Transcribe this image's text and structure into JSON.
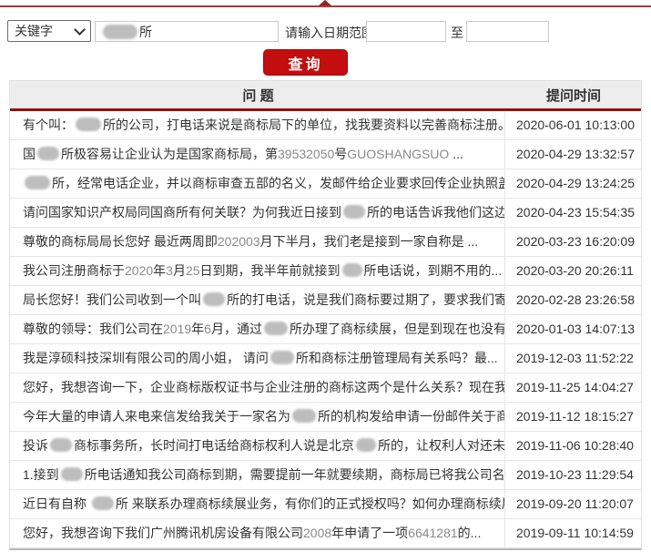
{
  "page": {
    "accent_red": "#c40d0e",
    "header_rule_red": "#9b0d0d",
    "top_rule_red": "#a43b3b"
  },
  "search": {
    "field_select": {
      "value": "关键字"
    },
    "keyword_input": {
      "visible_text": "所",
      "redacted_prefix": true
    },
    "date_range_label": "请输入日期范围",
    "to_label": "至",
    "date_from_value": "",
    "date_to_value": "",
    "submit_label": "查询"
  },
  "table": {
    "headers": {
      "question": "问 题",
      "time": "提问时间"
    },
    "rows": [
      {
        "q": [
          {
            "t": "有个叫："
          },
          {
            "r": 28
          },
          {
            "t": "所的公司，打电话来说是商标局下的单位，找我要资料以完善商标注册。但我..."
          }
        ],
        "time": "2020-06-01 10:13:00"
      },
      {
        "q": [
          {
            "t": "国"
          },
          {
            "r": 24
          },
          {
            "t": "所极容易让企业认为是国家商标局，第"
          },
          {
            "g": "39532050"
          },
          {
            "t": "号"
          },
          {
            "g": "GUOSHANGSUO"
          },
          {
            "t": " ..."
          }
        ],
        "time": "2020-04-29 13:32:57"
      },
      {
        "q": [
          {
            "r": 28
          },
          {
            "t": "所，经常电话企业，并以商标审查五部的名义，发邮件给企业要求回传企业执照盖章扫..."
          }
        ],
        "time": "2020-04-29 13:24:25"
      },
      {
        "q": [
          {
            "t": "请问国家知识产权局同国商所有何关联？为何我近日接到"
          },
          {
            "r": 24
          },
          {
            "t": "所的电话告诉我他们这边是知..."
          }
        ],
        "time": "2020-04-23 15:54:35"
      },
      {
        "q": [
          {
            "t": "尊敬的商标局局长您好 最近两周即"
          },
          {
            "g": "202003"
          },
          {
            "t": "月下半月，我们老是接到一家自称是 ..."
          }
        ],
        "time": "2020-03-23 16:20:09"
      },
      {
        "q": [
          {
            "t": "我公司注册商标于"
          },
          {
            "g": "2020"
          },
          {
            "t": "年"
          },
          {
            "g": "3"
          },
          {
            "t": "月"
          },
          {
            "g": "25"
          },
          {
            "t": "日到期，我半年前就接到"
          },
          {
            "r": 22
          },
          {
            "t": "所电话说，到期不用的..."
          }
        ],
        "time": "2020-03-20 20:26:11"
      },
      {
        "q": [
          {
            "t": "局长您好！我们公司收到一个叫"
          },
          {
            "r": 24
          },
          {
            "t": "所的打电话，说是我们商标要过期了，要求我们寄资料..."
          }
        ],
        "time": "2020-02-28 23:26:58"
      },
      {
        "q": [
          {
            "t": "尊敬的领导：我们公司在"
          },
          {
            "g": "2019"
          },
          {
            "t": "年"
          },
          {
            "g": "6"
          },
          {
            "t": "月，通过"
          },
          {
            "r": 26
          },
          {
            "t": "所办理了商标续展，但是到现在也没有..."
          }
        ],
        "time": "2020-01-03 14:07:13"
      },
      {
        "q": [
          {
            "t": "我是淳硕科技深圳有限公司的周小姐， 请问"
          },
          {
            "r": 26
          },
          {
            "t": "所和商标注册管理局有关系吗？最..."
          }
        ],
        "time": "2019-12-03 11:52:22"
      },
      {
        "q": [
          {
            "t": "您好，我想咨询一下，企业商标版权证书与企业注册的商标这两个是什么关系？现在我企业..."
          }
        ],
        "time": "2019-11-25 14:04:27"
      },
      {
        "q": [
          {
            "t": "今年大量的申请人来电来信发给我关于一家名为"
          },
          {
            "r": 26
          },
          {
            "t": "所的机构发给申请一份邮件关于商标续..."
          }
        ],
        "time": "2019-11-12 18:15:27"
      },
      {
        "q": [
          {
            "t": "投诉"
          },
          {
            "r": 24
          },
          {
            "t": "商标事务所，长时间打电话给商标权利人说是北京"
          },
          {
            "r": 22
          },
          {
            "t": "所的，让权利人对还未到续..."
          }
        ],
        "time": "2019-11-06 10:28:40"
      },
      {
        "q": [
          {
            "t": "1.接到"
          },
          {
            "r": 24
          },
          {
            "t": "所电话通知我公司商标到期，需要提前一年就要续期，商标局已将我公司名单..."
          }
        ],
        "time": "2019-10-23 11:29:54"
      },
      {
        "q": [
          {
            "t": "近日有自称 "
          },
          {
            "r": 24
          },
          {
            "t": "所 来联系办理商标续展业务，有你们的正式授权吗？如何办理商标续展..."
          }
        ],
        "time": "2019-09-20 11:20:07"
      },
      {
        "q": [
          {
            "t": "您好，我想咨询下我们广州腾讯机房设备有限公司"
          },
          {
            "g": "2008"
          },
          {
            "t": "年申请了一项"
          },
          {
            "g": "6641281"
          },
          {
            "t": "的..."
          }
        ],
        "time": "2019-09-11 10:14:59"
      }
    ]
  }
}
